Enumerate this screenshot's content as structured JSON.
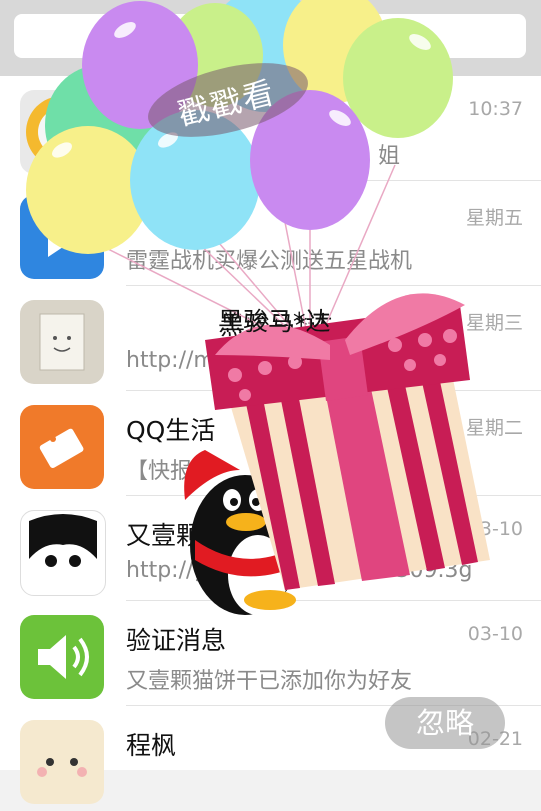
{
  "overlay": {
    "poke_label": "戳戳看",
    "gift_caption": "黑骏马*达",
    "ignore_label": "忽略"
  },
  "conversations": [
    {
      "name": "",
      "message": "姐",
      "time": "10:37"
    },
    {
      "name": "",
      "message": "雷霆战机买爆公测送五星战机",
      "time": "星期五"
    },
    {
      "name": "黑骏马*达",
      "message": "http://m",
      "time": "星期三"
    },
    {
      "name": "QQ生活",
      "message": "【快报】",
      "time": "星期二"
    },
    {
      "name": "又壹颗",
      "message": "http://ga",
      "message_tail": "s0309.3g",
      "time": "3-10"
    },
    {
      "name": "验证消息",
      "message": "又壹颗猫饼干已添加你为好友",
      "time": "03-10"
    },
    {
      "name": "程枫",
      "message": "",
      "time": "02-21"
    }
  ],
  "colors": {
    "balloon_purple": "#c98af0",
    "balloon_blue": "#8fe3f7",
    "balloon_yellow": "#f7f08a",
    "balloon_green": "#c9f08a",
    "balloon_teal": "#6fdfa8",
    "gift_pink": "#e0457f",
    "gift_red": "#c81d55"
  }
}
